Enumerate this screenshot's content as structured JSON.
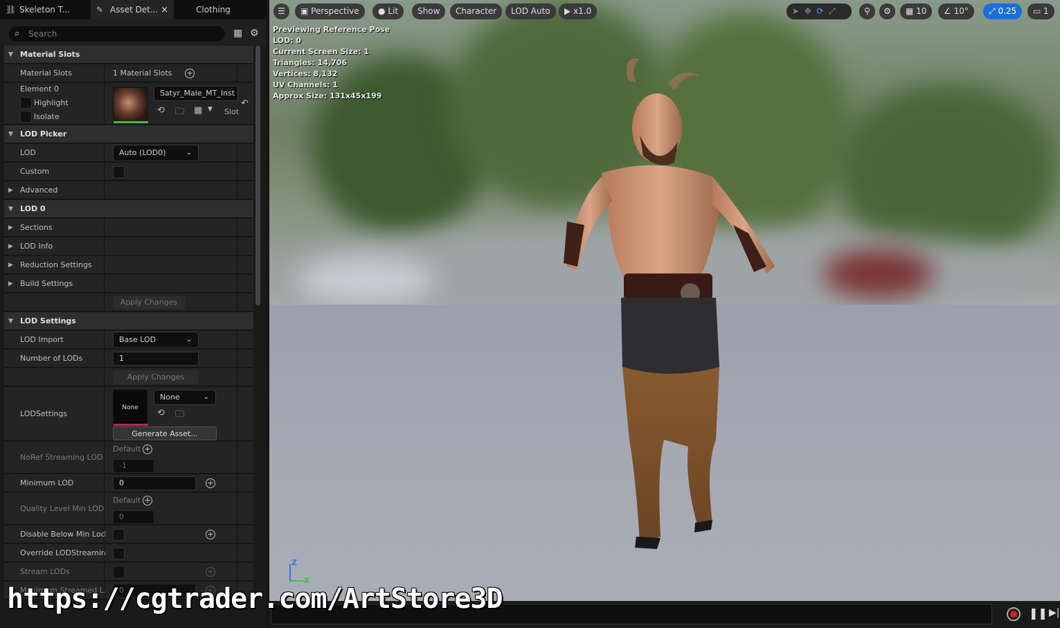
{
  "tabs": [
    {
      "label": "Skeleton T...",
      "icon": "skeleton-icon"
    },
    {
      "label": "Asset Det...",
      "icon": "asset-details-icon",
      "close": "×"
    },
    {
      "label": "Clothing"
    }
  ],
  "search": {
    "placeholder": "Search"
  },
  "sections": {
    "material_slots": {
      "title": "Material Slots",
      "count_label": "Material Slots",
      "count_value": "1 Material Slots",
      "element_label": "Element 0",
      "highlight": "Highlight",
      "isolate": "Isolate",
      "material_name": "Satyr_Male_MT_Inst",
      "slot_label": "Slot"
    },
    "lod_picker": {
      "title": "LOD Picker",
      "lod_label": "LOD",
      "lod_value": "Auto (LOD0)",
      "custom_label": "Custom",
      "advanced_label": "Advanced"
    },
    "lod0": {
      "title": "LOD 0",
      "items": [
        "Sections",
        "LOD Info",
        "Reduction Settings",
        "Build Settings"
      ],
      "apply_label": "Apply Changes"
    },
    "lod_settings": {
      "title": "LOD Settings",
      "import_label": "LOD Import",
      "import_value": "Base LOD",
      "num_label": "Number of LODs",
      "num_value": "1",
      "apply_label": "Apply Changes",
      "lodsettings_label": "LODSettings",
      "lodsettings_thumb": "None",
      "lodsettings_value": "None",
      "generate_label": "Generate Asset...",
      "noref_label": "NoRef Streaming LOD B",
      "noref_default": "Default",
      "noref_value": "-1",
      "minlod_label": "Minimum LOD",
      "minlod_value": "0",
      "quality_label": "Quality Level Min LOD",
      "quality_default": "Default",
      "quality_value": "0",
      "disable_below_label": "Disable Below Min Lod...",
      "override_label": "Override LODStreamin...",
      "stream_label": "Stream LODs",
      "max_streamed_label": "Maximum Streamed L...",
      "max_streamed_value": "0"
    }
  },
  "viewport": {
    "toolbar": {
      "perspective": "Perspective",
      "lit": "Lit",
      "show": "Show",
      "character": "Character",
      "lod": "LOD Auto",
      "speed": "x1.0",
      "grid_value": "10",
      "angle_value": "10°",
      "scale_value": "0.25",
      "camera_value": "1"
    },
    "stats": [
      "Previewing Reference Pose",
      "LOD: 0",
      "Current Screen Size: 1",
      "Triangles: 14,706",
      "Vertices: 8,132",
      "UV Channels: 1",
      "Approx Size: 131x45x199"
    ],
    "axis": {
      "z": "Z",
      "x": "X"
    }
  },
  "watermark": "https://cgtrader.com/ArtStore3D",
  "colors": {
    "accent": "#1a6fd6",
    "record": "#d42020",
    "thumb_bar": "#3dbb4a",
    "none_bar": "#c0264a"
  }
}
